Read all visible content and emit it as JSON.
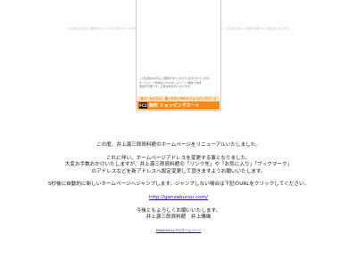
{
  "top_notice": "この広告は90日以上更新がないブログに表示されています。ホームページ作成ならFC2ホームページ 無料で作成・運営が可能です。この広告は新しい記事を投稿すると非表示になります。",
  "ad": {
    "text_lines": [
      "この広告は90日以上更新がないブログに表示されています。",
      "ホームページ作成ならFC2ホームページ 無料で作成",
      "運営が可能です。広告は非表示になります。"
    ],
    "banner_top": "安心・かんたん・使いやすいPRO＊ショッピングカート",
    "banner_logo": "FC2",
    "banner_main": "無料 ショッピングカート",
    "colors": {
      "banner": "#f08a1c",
      "banner_top": "#fbe3b6"
    }
  },
  "content": {
    "line1": "この度、井上源三郎資料館のホームページをリニューアルいたしました。",
    "line2": "これに伴い、ホームページアドレスを変更する事となりました。",
    "line3": "大変お手数おかけいたしますが、井上源三郎資料館の「リンク先」や「お気に入り」「ブックマーク」",
    "line4": "のアドレスなどを新アドレスへ設定変更して頂きますようお願いいたします。",
    "line5": "5秒後に自動的に新しいホームページへジャンプします。ジャンプしない場合は下記のURLをクリックしてください。",
    "new_url": "http://genzaburou.com/",
    "line6": "今後ともよろしくお願いいたします。",
    "line7": "井上源三郎資料館　井上雅雄",
    "footer_link": "Powered by FC2ホームページ"
  }
}
